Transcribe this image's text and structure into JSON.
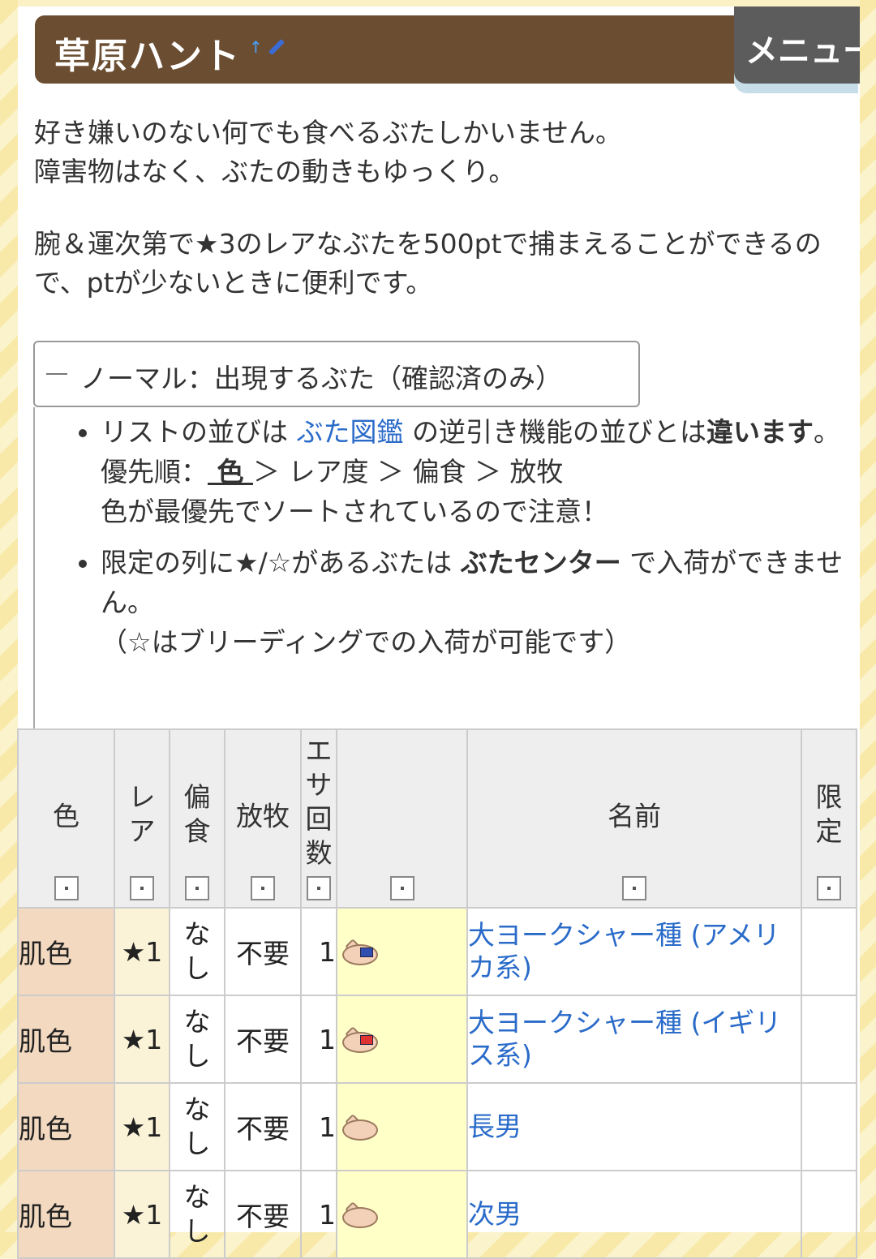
{
  "title": "草原ハント",
  "menu_label": "メニュー",
  "paragraph1": "好き嫌いのない何でも食べるぶたしかいません。\n障害物はなく、ぶたの動きもゆっくり。",
  "paragraph2": "腕＆運次第で★3のレアなぶたを500ptで捕まえることができるので、ptが少ないときに便利です。",
  "fold": {
    "symbol": "−",
    "label": "ノーマル：出現するぶた（確認済のみ）"
  },
  "notes": {
    "n1_a": "リストの並びは ",
    "n1_link": "ぶた図鑑",
    "n1_b": " の逆引き機能の並びとは",
    "n1_bold": "違います",
    "n1_c": "。",
    "n1_priority_a": "優先順：",
    "n1_priority_u": " 色 ",
    "n1_priority_b": "＞ レア度 ＞ 偏食 ＞ 放牧",
    "n1_line3": "色が最優先でソートされているので注意！",
    "n2_a": "限定の列に★/☆があるぶたは ",
    "n2_bold": "ぶたセンター",
    "n2_b": " で入荷ができません。",
    "n2_line3": "（☆はブリーディングでの入荷が可能です）"
  },
  "table": {
    "headers": {
      "color": "色",
      "rare": "レ\nア",
      "feed": "偏\n食",
      "free": "放牧",
      "count": "エ\nサ\n回\n数",
      "image": "",
      "name": "名前",
      "limited": "限\n定"
    },
    "rows": [
      {
        "color": "肌色",
        "rare": "★1",
        "feed": "な\nし",
        "free": "不要",
        "count": "1",
        "name": "大ヨークシャー種 (アメリカ系)",
        "limited": ""
      },
      {
        "color": "肌色",
        "rare": "★1",
        "feed": "な\nし",
        "free": "不要",
        "count": "1",
        "name": "大ヨークシャー種 (イギリス系)",
        "limited": ""
      },
      {
        "color": "肌色",
        "rare": "★1",
        "feed": "な\nし",
        "free": "不要",
        "count": "1",
        "name": "長男",
        "limited": ""
      },
      {
        "color": "肌色",
        "rare": "★1",
        "feed": "な\nし",
        "free": "不要",
        "count": "1",
        "name": "次男",
        "limited": ""
      }
    ]
  },
  "icons": {
    "sort": "sort-icon",
    "pig": "pig-icon",
    "up": "up-arrow-icon",
    "edit": "pencil-icon"
  }
}
